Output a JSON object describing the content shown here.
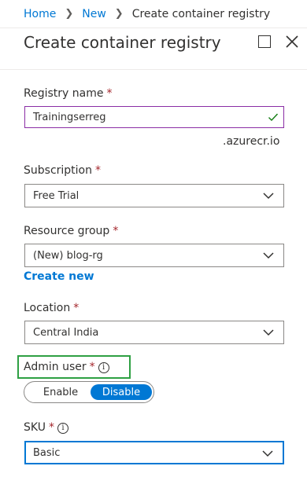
{
  "breadcrumb": {
    "home": "Home",
    "new": "New",
    "current": "Create container registry"
  },
  "page": {
    "title": "Create container registry"
  },
  "registry_name": {
    "label": "Registry name",
    "required_mark": "*",
    "value": "Trainingserreg",
    "suffix": ".azurecr.io"
  },
  "subscription": {
    "label": "Subscription",
    "required_mark": "*",
    "value": "Free Trial"
  },
  "resource_group": {
    "label": "Resource group",
    "required_mark": "*",
    "value": "(New) blog-rg",
    "create_new": "Create new"
  },
  "location": {
    "label": "Location",
    "required_mark": "*",
    "value": "Central India"
  },
  "admin_user": {
    "label": "Admin user",
    "required_mark": "*",
    "info_glyph": "i",
    "options": [
      "Enable",
      "Disable"
    ],
    "selected": "Disable"
  },
  "sku": {
    "label": "SKU",
    "required_mark": "*",
    "info_glyph": "i",
    "value": "Basic"
  },
  "colors": {
    "accent": "#0078d4",
    "required": "#a4262c",
    "valid_check": "#107c10",
    "highlight_box": "#2ea043",
    "focused_border": "#8a2da5"
  }
}
